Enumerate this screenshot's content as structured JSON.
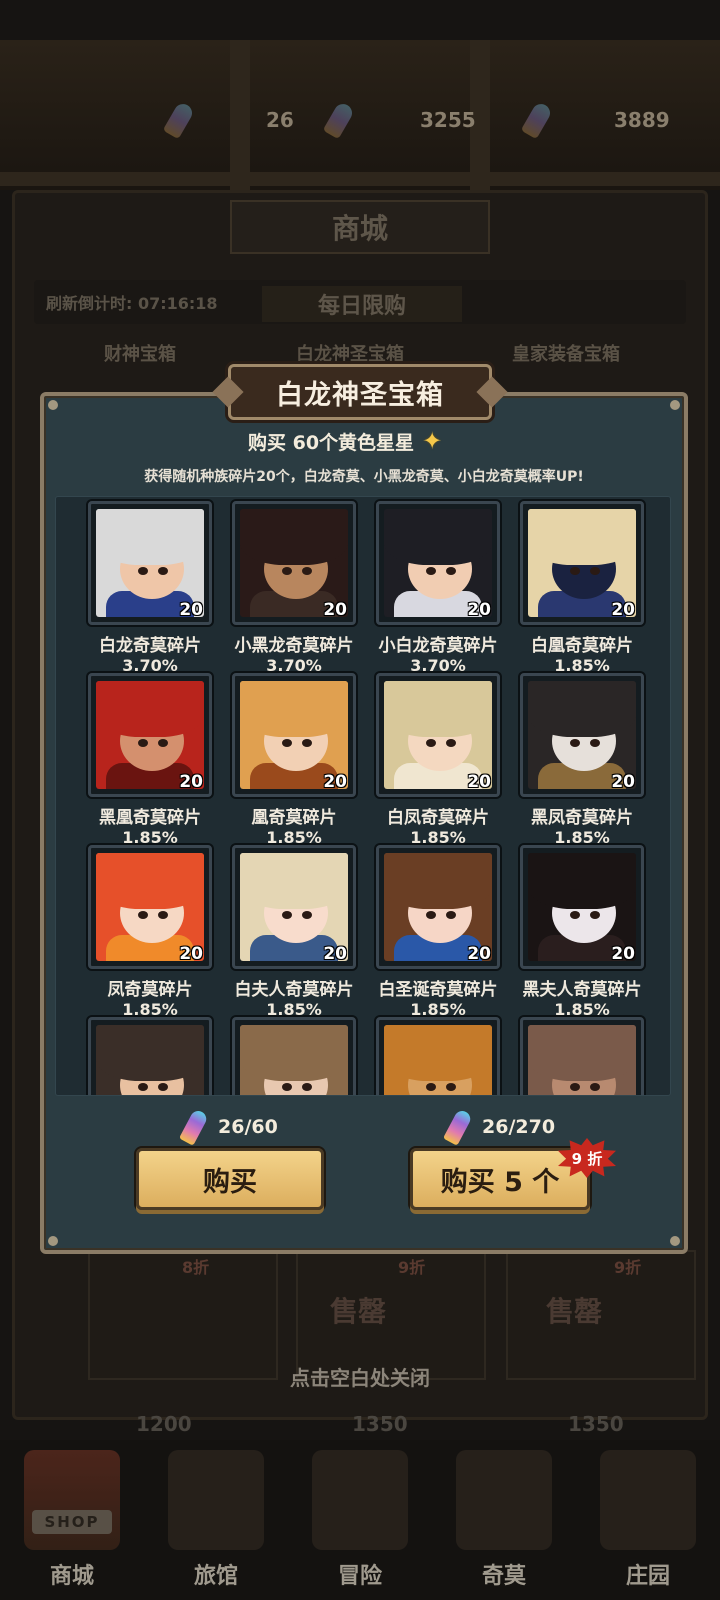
{
  "background": {
    "resources": [
      "26",
      "3255",
      "3889"
    ],
    "shop_title": "商城",
    "countdown": "刷新倒计时: 07:16:18",
    "daily_tab": "每日限购",
    "tabs": [
      "财神宝箱",
      "白龙神圣宝箱",
      "皇家装备宝箱"
    ],
    "sold_out": "售罄",
    "discounts": [
      "8折",
      "9折",
      "9折"
    ],
    "prices": [
      "1200",
      "1350",
      "1350"
    ],
    "close_hint": "点击空白处关闭"
  },
  "bottom_nav": [
    {
      "label": "商城",
      "sign": "SHOP"
    },
    {
      "label": "旅馆"
    },
    {
      "label": "冒险"
    },
    {
      "label": "奇莫"
    },
    {
      "label": "庄园"
    }
  ],
  "modal": {
    "title": "白龙神圣宝箱",
    "subtitle": "购买 60个黄色星星",
    "star_glyph": "✦",
    "description": "获得随机种族碎片20个，白龙奇莫、小黑龙奇莫、小白龙奇莫概率UP!",
    "items": [
      {
        "name": "白龙奇莫碎片",
        "pct": "3.70%",
        "count": "20",
        "hair": "#d9d9d9",
        "body": "#2a3f8a",
        "skin": "#efc6a8"
      },
      {
        "name": "小黑龙奇莫碎片",
        "pct": "3.70%",
        "count": "20",
        "hair": "#2a1a18",
        "body": "#3a2a24",
        "skin": "#b8865e"
      },
      {
        "name": "小白龙奇莫碎片",
        "pct": "3.70%",
        "count": "20",
        "hair": "#1e1e24",
        "body": "#d8d8e0",
        "skin": "#f1cdb2"
      },
      {
        "name": "白凰奇莫碎片",
        "pct": "1.85%",
        "count": "20",
        "hair": "#e6d4a8",
        "body": "#2a3870",
        "skin": "#1a2240"
      },
      {
        "name": "黑凰奇莫碎片",
        "pct": "1.85%",
        "count": "20",
        "hair": "#b8241c",
        "body": "#6a1410",
        "skin": "#d4906e"
      },
      {
        "name": "凰奇莫碎片",
        "pct": "1.85%",
        "count": "20",
        "hair": "#e0a050",
        "body": "#9a4a1c",
        "skin": "#f2d0b4"
      },
      {
        "name": "白凤奇莫碎片",
        "pct": "1.85%",
        "count": "20",
        "hair": "#d8c89a",
        "body": "#f0e6d0",
        "skin": "#f4d8c0"
      },
      {
        "name": "黑凤奇莫碎片",
        "pct": "1.85%",
        "count": "20",
        "hair": "#2a2626",
        "body": "#8a6a3a",
        "skin": "#e6e0da"
      },
      {
        "name": "凤奇莫碎片",
        "pct": "1.85%",
        "count": "20",
        "hair": "#e6502a",
        "body": "#f08a2a",
        "skin": "#f6d8c4"
      },
      {
        "name": "白夫人奇莫碎片",
        "pct": "1.85%",
        "count": "20",
        "hair": "#e4d6b4",
        "body": "#3a5a8a",
        "skin": "#f8dccc"
      },
      {
        "name": "白圣诞奇莫碎片",
        "pct": "1.85%",
        "count": "20",
        "hair": "#6a3e24",
        "body": "#2a58a8",
        "skin": "#f6d6c6"
      },
      {
        "name": "黑夫人奇莫碎片",
        "pct": "1.85%",
        "count": "20",
        "hair": "#1a1414",
        "body": "#2a1e1e",
        "skin": "#ece6ea"
      },
      {
        "name": "",
        "pct": "",
        "count": "",
        "hair": "#3a2e28",
        "body": "#1a1a1a",
        "skin": "#e8c0a0"
      },
      {
        "name": "",
        "pct": "",
        "count": "",
        "hair": "#8a6a4a",
        "body": "#4a3a2a",
        "skin": "#e8c8b0"
      },
      {
        "name": "",
        "pct": "",
        "count": "",
        "hair": "#c47a2a",
        "body": "#6a3a14",
        "skin": "#d8a060"
      },
      {
        "name": "",
        "pct": "",
        "count": "",
        "hair": "#7a5a4a",
        "body": "#4a3028",
        "skin": "#b88a70"
      }
    ],
    "cost_single": "26/60",
    "cost_multi": "26/270",
    "buy_label": "购买",
    "buy5_label": "购买 5 个",
    "discount_badge": "9 折"
  }
}
